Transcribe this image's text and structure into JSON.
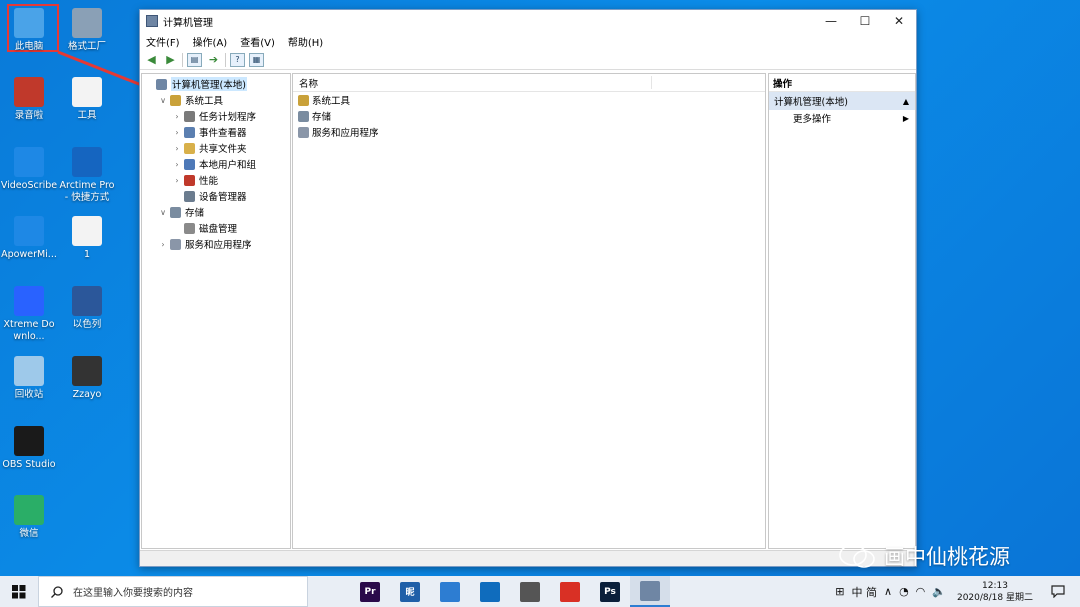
{
  "desktop": {
    "icons": [
      {
        "label": "此电脑",
        "color": "#4aa3e8",
        "icon": "computer-icon"
      },
      {
        "label": "格式工厂",
        "color": "#8aa0b6",
        "icon": "format-factory-icon"
      },
      {
        "label": "录音啦",
        "color": "#c0392b",
        "icon": "recorder-icon"
      },
      {
        "label": "工具",
        "color": "#f3f3f3",
        "icon": "document-icon"
      },
      {
        "label": "VideoScribe",
        "color": "#1e88e5",
        "icon": "videoscribe-icon"
      },
      {
        "label": "Arctime Pro - 快捷方式",
        "color": "#1565c0",
        "icon": "arctime-icon"
      },
      {
        "label": "ApowerMi...",
        "color": "#1e88e5",
        "icon": "apowermirror-icon"
      },
      {
        "label": "1",
        "color": "#f3f3f3",
        "icon": "document-icon"
      },
      {
        "label": "Xtreme Downlo...",
        "color": "#2962ff",
        "icon": "xtreme-download-icon"
      },
      {
        "label": "以色列",
        "color": "#2b579a",
        "icon": "word-icon"
      },
      {
        "label": "回收站",
        "color": "#9ec9ea",
        "icon": "recycle-bin-icon"
      },
      {
        "label": "Zzayo",
        "color": "#333333",
        "icon": "video-thumbnail-icon"
      },
      {
        "label": "OBS Studio",
        "color": "#1a1a1a",
        "icon": "obs-icon"
      },
      {
        "label": "微信",
        "color": "#2aae67",
        "icon": "wechat-icon"
      }
    ]
  },
  "window": {
    "title": "计算机管理",
    "menu": [
      "文件(F)",
      "操作(A)",
      "查看(V)",
      "帮助(H)"
    ],
    "tree": [
      {
        "label": "计算机管理(本地)",
        "level": 0,
        "expander": "",
        "color": "#6f86a4",
        "selected": true
      },
      {
        "label": "系统工具",
        "level": 1,
        "expander": "∨",
        "color": "#c9a13a"
      },
      {
        "label": "任务计划程序",
        "level": 2,
        "expander": "›",
        "color": "#7a7a7a"
      },
      {
        "label": "事件查看器",
        "level": 2,
        "expander": "›",
        "color": "#5b7fb0"
      },
      {
        "label": "共享文件夹",
        "level": 2,
        "expander": "›",
        "color": "#d8b04a"
      },
      {
        "label": "本地用户和组",
        "level": 2,
        "expander": "›",
        "color": "#4e79b8"
      },
      {
        "label": "性能",
        "level": 2,
        "expander": "›",
        "color": "#c0392b"
      },
      {
        "label": "设备管理器",
        "level": 2,
        "expander": "",
        "color": "#6b7c8f"
      },
      {
        "label": "存储",
        "level": 1,
        "expander": "∨",
        "color": "#7a8ca0"
      },
      {
        "label": "磁盘管理",
        "level": 2,
        "expander": "",
        "color": "#8a8a8a"
      },
      {
        "label": "服务和应用程序",
        "level": 1,
        "expander": "›",
        "color": "#8a96a8"
      }
    ],
    "center": {
      "column_header": "名称",
      "items": [
        {
          "label": "系统工具",
          "color": "#c9a13a"
        },
        {
          "label": "存储",
          "color": "#7a8ca0"
        },
        {
          "label": "服务和应用程序",
          "color": "#8a96a8"
        }
      ]
    },
    "actions": {
      "title": "操作",
      "selected": "计算机管理(本地)",
      "more": "更多操作"
    }
  },
  "watermark": {
    "text": "画中仙桃花源"
  },
  "taskbar": {
    "search_placeholder": "在这里输入你要搜索的内容",
    "apps": [
      {
        "name": "premiere-icon",
        "text": "Pr",
        "color": "#2a0a4a"
      },
      {
        "name": "app-icon",
        "text": "昵",
        "color": "#1f5fa8"
      },
      {
        "name": "store-icon",
        "text": "",
        "color": "#2d7dd2"
      },
      {
        "name": "mail-icon",
        "text": "",
        "color": "#0f6cbd"
      },
      {
        "name": "calculator-icon",
        "text": "",
        "color": "#555555"
      },
      {
        "name": "chrome-icon",
        "text": "",
        "color": "#d93025"
      },
      {
        "name": "photoshop-icon",
        "text": "Ps",
        "color": "#0a1f3a"
      },
      {
        "name": "computer-management-icon",
        "text": "",
        "color": "#6f86a4",
        "active": true
      }
    ],
    "ime": "中 简",
    "time": "12:13",
    "date": "2020/8/18 星期二"
  }
}
